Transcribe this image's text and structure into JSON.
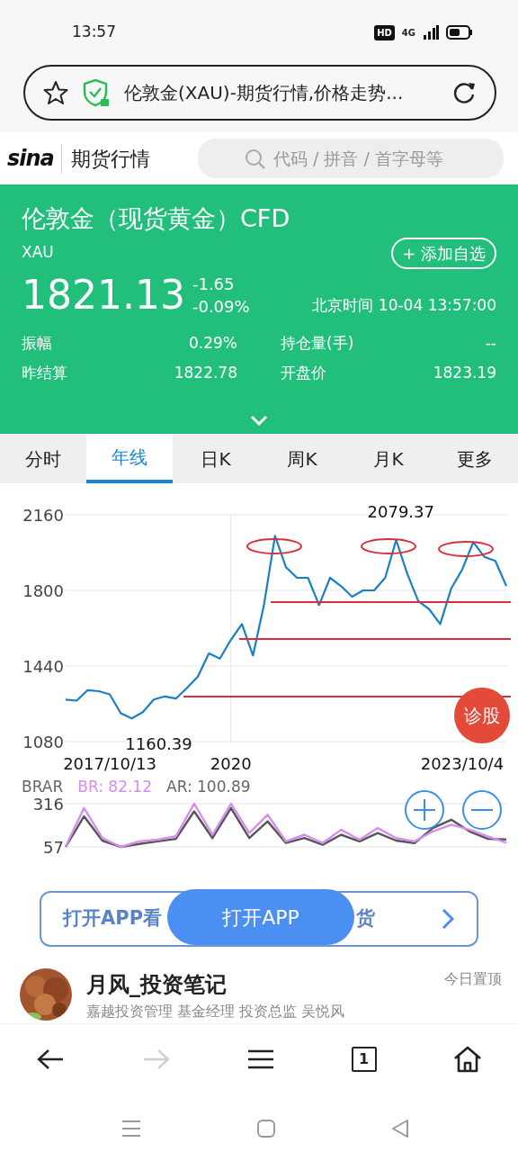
{
  "status_bar": {
    "time": "13:57",
    "hd_badge": "HD",
    "network": "4G"
  },
  "address_bar": {
    "title": "伦敦金(XAU)-期货行情,价格走势..."
  },
  "site_header": {
    "logo": "sina",
    "section": "期货行情",
    "search": {
      "placeholder": "代码 / 拼音 / 首字母等"
    }
  },
  "quote": {
    "name": "伦敦金（现货黄金）CFD",
    "code": "XAU",
    "add_button": "+ 添加自选",
    "price": "1821.13",
    "change": "-1.65",
    "change_pct": "-0.09%",
    "time": "北京时间 10-04 13:57:00",
    "stats": [
      {
        "label": "振幅",
        "value": "0.29%"
      },
      {
        "label": "持仓量(手)",
        "value": "--"
      },
      {
        "label": "昨结算",
        "value": "1822.78"
      },
      {
        "label": "开盘价",
        "value": "1823.19"
      }
    ]
  },
  "tabs": [
    {
      "label": "分时",
      "selected": false
    },
    {
      "label": "年线",
      "selected": true
    },
    {
      "label": "日K",
      "selected": false
    },
    {
      "label": "周K",
      "selected": false
    },
    {
      "label": "月K",
      "selected": false
    },
    {
      "label": "更多",
      "selected": false
    }
  ],
  "price_chart": {
    "chart_data": {
      "type": "line",
      "grid": true,
      "ylim": [
        1080,
        2160
      ],
      "yticks": [
        1080,
        1440,
        1800,
        2160
      ],
      "categories": [
        null,
        null,
        null,
        null,
        "2017/10/13",
        null,
        null,
        null,
        null,
        null,
        null,
        null,
        null,
        null,
        null,
        "2020",
        null,
        null,
        null,
        null,
        null,
        null,
        null,
        null,
        null,
        null,
        null,
        null,
        null,
        null,
        null,
        null,
        null,
        null,
        null,
        null,
        "2023/10/4",
        null,
        null,
        null,
        null
      ],
      "series": [
        {
          "color": "#1a7fc4",
          "values": [
            1280,
            1275,
            1325,
            1320,
            1305,
            1215,
            1190,
            1220,
            1280,
            1295,
            1285,
            1335,
            1390,
            1500,
            1475,
            1565,
            1640,
            1490,
            1730,
            2060,
            1910,
            1860,
            1860,
            1730,
            1860,
            1820,
            1770,
            1800,
            1800,
            1860,
            2040,
            1880,
            1750,
            1710,
            1640,
            1810,
            1900,
            2030,
            1960,
            1940,
            1821
          ]
        }
      ],
      "annotations": [
        "1160.39",
        "2079.37"
      ]
    }
  },
  "indicator": {
    "name": "BRAR",
    "chart_data": {
      "type": "line",
      "ylim": [
        57,
        316
      ],
      "yticks": [
        57,
        316
      ],
      "series": [
        {
          "name": "AR: 100.89",
          "color": "#555555",
          "values": [
            57,
            240,
            95,
            57,
            75,
            90,
            105,
            270,
            110,
            290,
            110,
            210,
            80,
            110,
            70,
            130,
            90,
            140,
            95,
            80,
            170,
            220,
            150,
            105,
            101
          ]
        },
        {
          "name": "BR: 82.12",
          "color": "#d58ef0",
          "values": [
            60,
            290,
            110,
            57,
            90,
            100,
            120,
            316,
            130,
            316,
            140,
            250,
            90,
            130,
            80,
            160,
            100,
            170,
            110,
            90,
            150,
            190,
            160,
            120,
            82
          ]
        }
      ]
    }
  },
  "chart_controls": {
    "diagnose_button": "诊股"
  },
  "banner": {
    "text_before": "打开APP看",
    "text_after": "货",
    "overlay_button": "打开APP"
  },
  "post": {
    "author": "月风_投资笔记",
    "subtitle": "嘉越投资管理 基金经理 投资总监 吴悦风",
    "tag": "今日置顶"
  },
  "browser_toolbar": [
    {
      "kind": "back",
      "disabled": false
    },
    {
      "kind": "forward",
      "disabled": true
    },
    {
      "kind": "menu",
      "disabled": false
    },
    {
      "kind": "tabs",
      "label": "1",
      "disabled": false
    },
    {
      "kind": "home",
      "disabled": false
    }
  ]
}
